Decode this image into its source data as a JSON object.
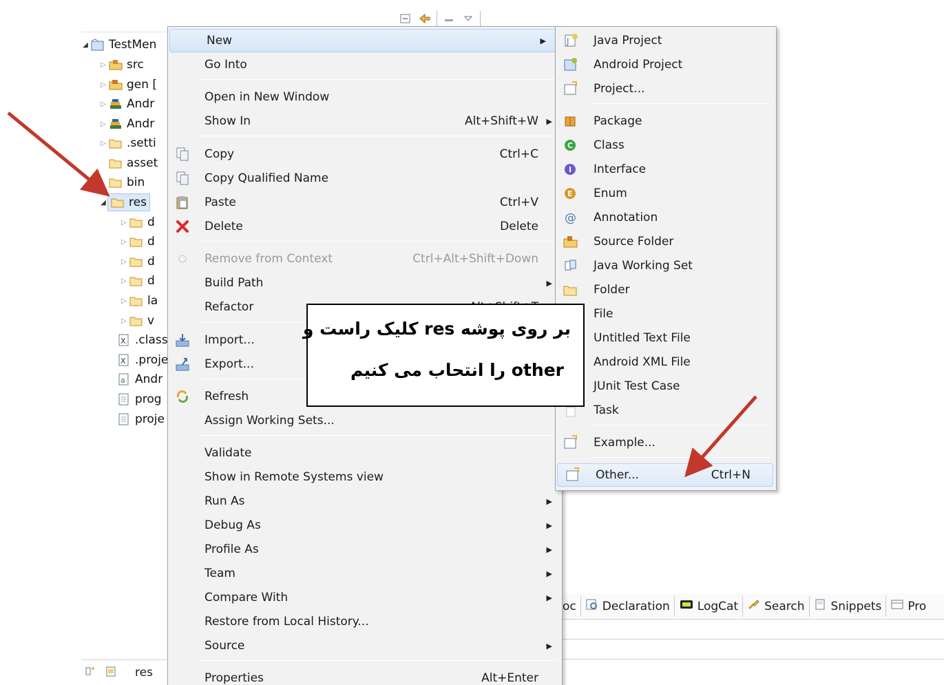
{
  "explorer": {
    "project_name": "TestMen",
    "items": [
      {
        "label": "src"
      },
      {
        "label": "gen ["
      },
      {
        "label": "Andr"
      },
      {
        "label": "Andr"
      },
      {
        "label": ".setti"
      },
      {
        "label": "asset"
      },
      {
        "label": "bin"
      },
      {
        "label": "res"
      },
      {
        "label": "d"
      },
      {
        "label": "d"
      },
      {
        "label": "d"
      },
      {
        "label": "d"
      },
      {
        "label": "la"
      },
      {
        "label": "v"
      },
      {
        "label": ".class"
      },
      {
        "label": ".proje"
      },
      {
        "label": "Andr"
      },
      {
        "label": "prog"
      },
      {
        "label": "proje"
      }
    ]
  },
  "status": {
    "selected": "res"
  },
  "context_menu": {
    "items": [
      {
        "label": "New",
        "shortcut": "",
        "submenu": true
      },
      {
        "label": "Go Into",
        "shortcut": ""
      },
      {
        "label": "Open in New Window",
        "shortcut": ""
      },
      {
        "label": "Show In",
        "shortcut": "Alt+Shift+W",
        "submenu": true
      },
      {
        "label": "Copy",
        "shortcut": "Ctrl+C"
      },
      {
        "label": "Copy Qualified Name",
        "shortcut": ""
      },
      {
        "label": "Paste",
        "shortcut": "Ctrl+V"
      },
      {
        "label": "Delete",
        "shortcut": "Delete"
      },
      {
        "label": "Remove from Context",
        "shortcut": "Ctrl+Alt+Shift+Down",
        "disabled": true
      },
      {
        "label": "Build Path",
        "shortcut": "",
        "submenu": true
      },
      {
        "label": "Refactor",
        "shortcut": "Alt+Shift+T",
        "submenu": true
      },
      {
        "label": "Import...",
        "shortcut": ""
      },
      {
        "label": "Export...",
        "shortcut": ""
      },
      {
        "label": "Refresh",
        "shortcut": ""
      },
      {
        "label": "Assign Working Sets...",
        "shortcut": ""
      },
      {
        "label": "Validate",
        "shortcut": ""
      },
      {
        "label": "Show in Remote Systems view",
        "shortcut": ""
      },
      {
        "label": "Run As",
        "shortcut": "",
        "submenu": true
      },
      {
        "label": "Debug As",
        "shortcut": "",
        "submenu": true
      },
      {
        "label": "Profile As",
        "shortcut": "",
        "submenu": true
      },
      {
        "label": "Team",
        "shortcut": "",
        "submenu": true
      },
      {
        "label": "Compare With",
        "shortcut": "",
        "submenu": true
      },
      {
        "label": "Restore from Local History...",
        "shortcut": ""
      },
      {
        "label": "Source",
        "shortcut": "",
        "submenu": true
      },
      {
        "label": "Properties",
        "shortcut": "Alt+Enter"
      }
    ]
  },
  "new_submenu": {
    "items": [
      {
        "label": "Java Project",
        "shortcut": ""
      },
      {
        "label": "Android Project",
        "shortcut": ""
      },
      {
        "label": "Project...",
        "shortcut": ""
      },
      {
        "label": "Package",
        "shortcut": ""
      },
      {
        "label": "Class",
        "shortcut": ""
      },
      {
        "label": "Interface",
        "shortcut": ""
      },
      {
        "label": "Enum",
        "shortcut": ""
      },
      {
        "label": "Annotation",
        "shortcut": ""
      },
      {
        "label": "Source Folder",
        "shortcut": ""
      },
      {
        "label": "Java Working Set",
        "shortcut": ""
      },
      {
        "label": "Folder",
        "shortcut": ""
      },
      {
        "label": "File",
        "shortcut": ""
      },
      {
        "label": "Untitled Text File",
        "shortcut": ""
      },
      {
        "label": "Android XML File",
        "shortcut": ""
      },
      {
        "label": "JUnit Test Case",
        "shortcut": ""
      },
      {
        "label": "Task",
        "shortcut": ""
      },
      {
        "label": "Example...",
        "shortcut": ""
      },
      {
        "label": "Other...",
        "shortcut": "Ctrl+N"
      }
    ]
  },
  "view_tabs": [
    {
      "label": "oc"
    },
    {
      "label": "Declaration"
    },
    {
      "label": "LogCat"
    },
    {
      "label": "Search"
    },
    {
      "label": "Snippets"
    },
    {
      "label": "Pro"
    }
  ],
  "annotation": {
    "line1": "بر روی پوشه res کلیک راست و",
    "line2": "other را انتحاب می کنیم",
    "arrow_color": "#c0392b"
  }
}
